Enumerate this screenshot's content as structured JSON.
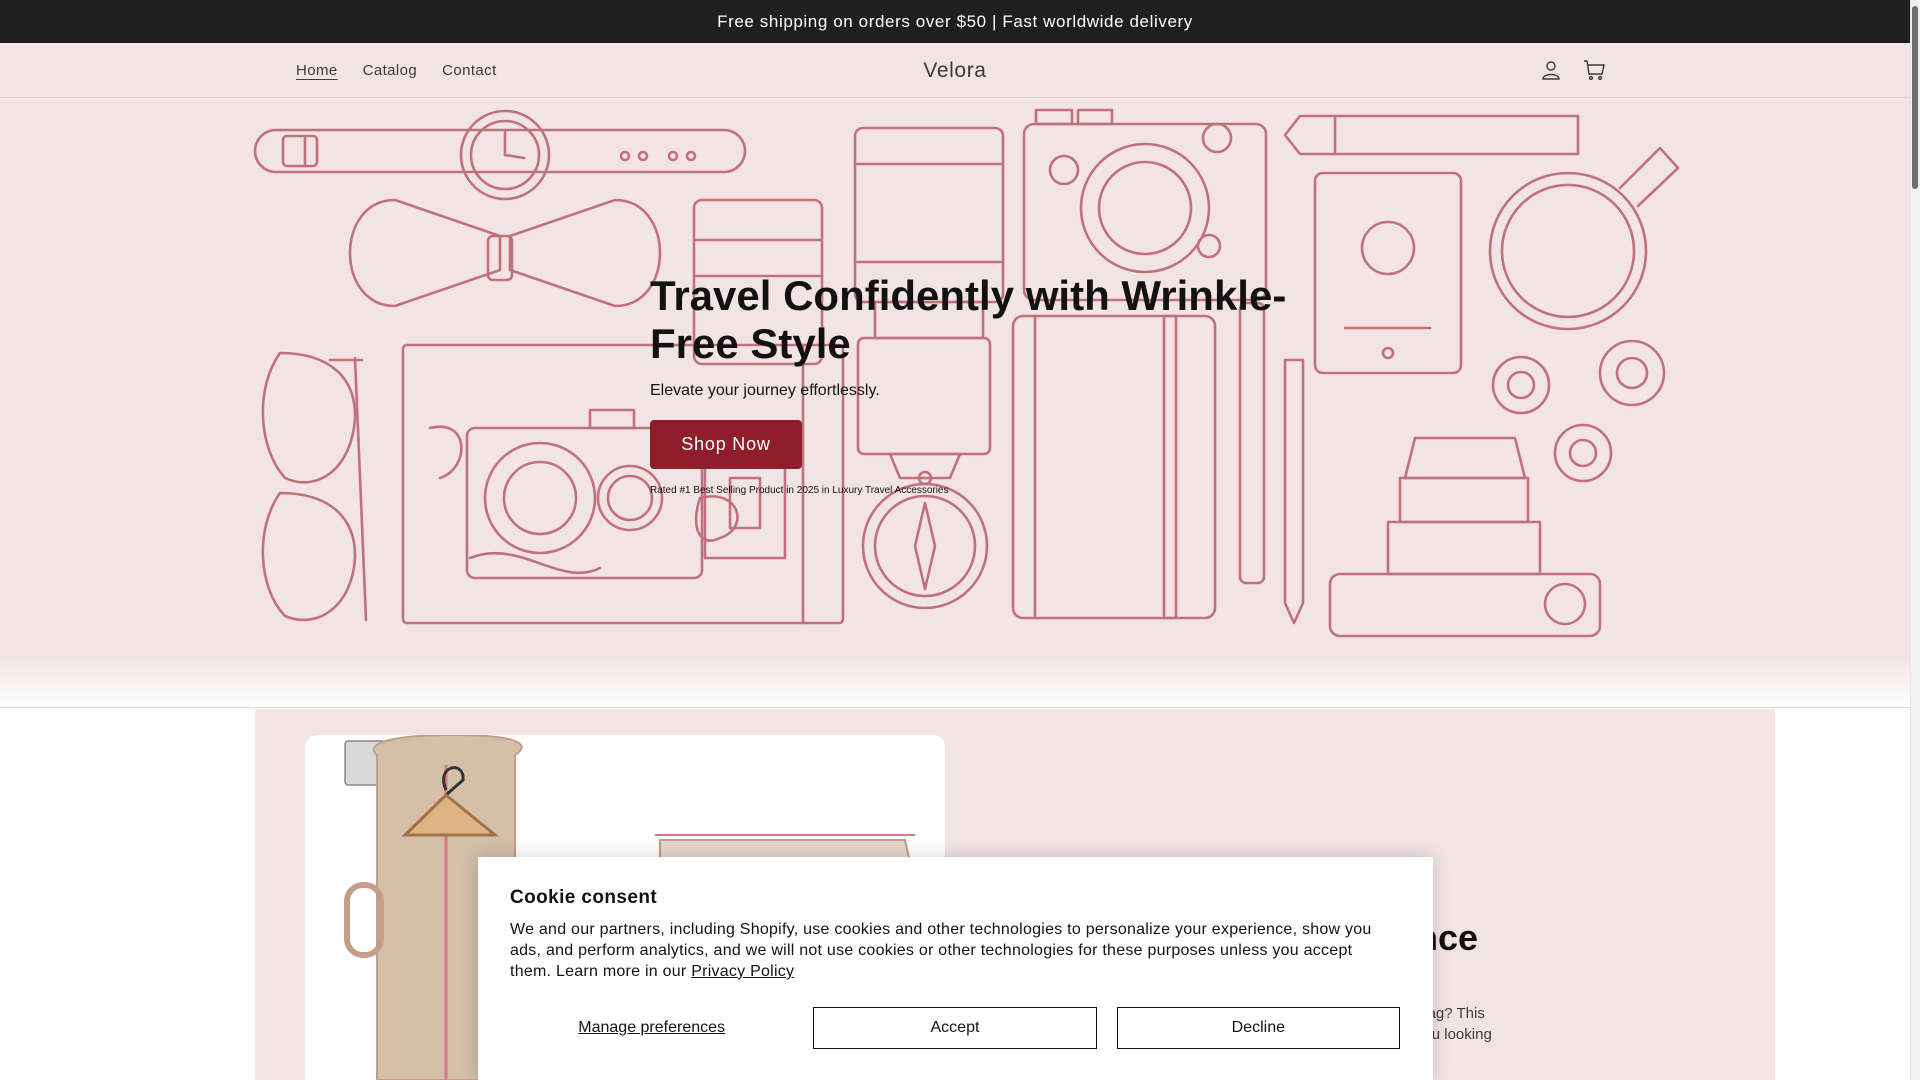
{
  "announcement": "Free shipping on orders over $50 | Fast worldwide delivery",
  "header": {
    "nav": [
      "Home",
      "Catalog",
      "Contact"
    ],
    "brand": "Velora",
    "icons": [
      "account-icon",
      "cart-icon"
    ]
  },
  "hero": {
    "title": "Travel Confidently with Wrinkle-Free Style",
    "subtitle": "Elevate your journey effortlessly.",
    "button": "Shop Now",
    "note": "Rated #1 Best Selling Product in 2025 in Luxury Travel Accessories"
  },
  "feature": {
    "title_visible": "perience",
    "text_lines": [
      "disorganized bag? This",
      "ns and keep you looking"
    ]
  },
  "cookie": {
    "title": "Cookie consent",
    "body": "We and our partners, including Shopify, use cookies and other technologies to personalize your experience, show you ads, and perform analytics, and we will not use cookies or other technologies for these purposes unless you accept them. Learn more in our ",
    "policy_link": "Privacy Policy",
    "manage": "Manage preferences",
    "accept": "Accept",
    "decline": "Decline"
  },
  "colors": {
    "announcement_bg": "#1f1f1f",
    "hero_bg": "#f2e4e5",
    "line_art": "#c0727c",
    "accent_button": "#8f1d2a"
  }
}
